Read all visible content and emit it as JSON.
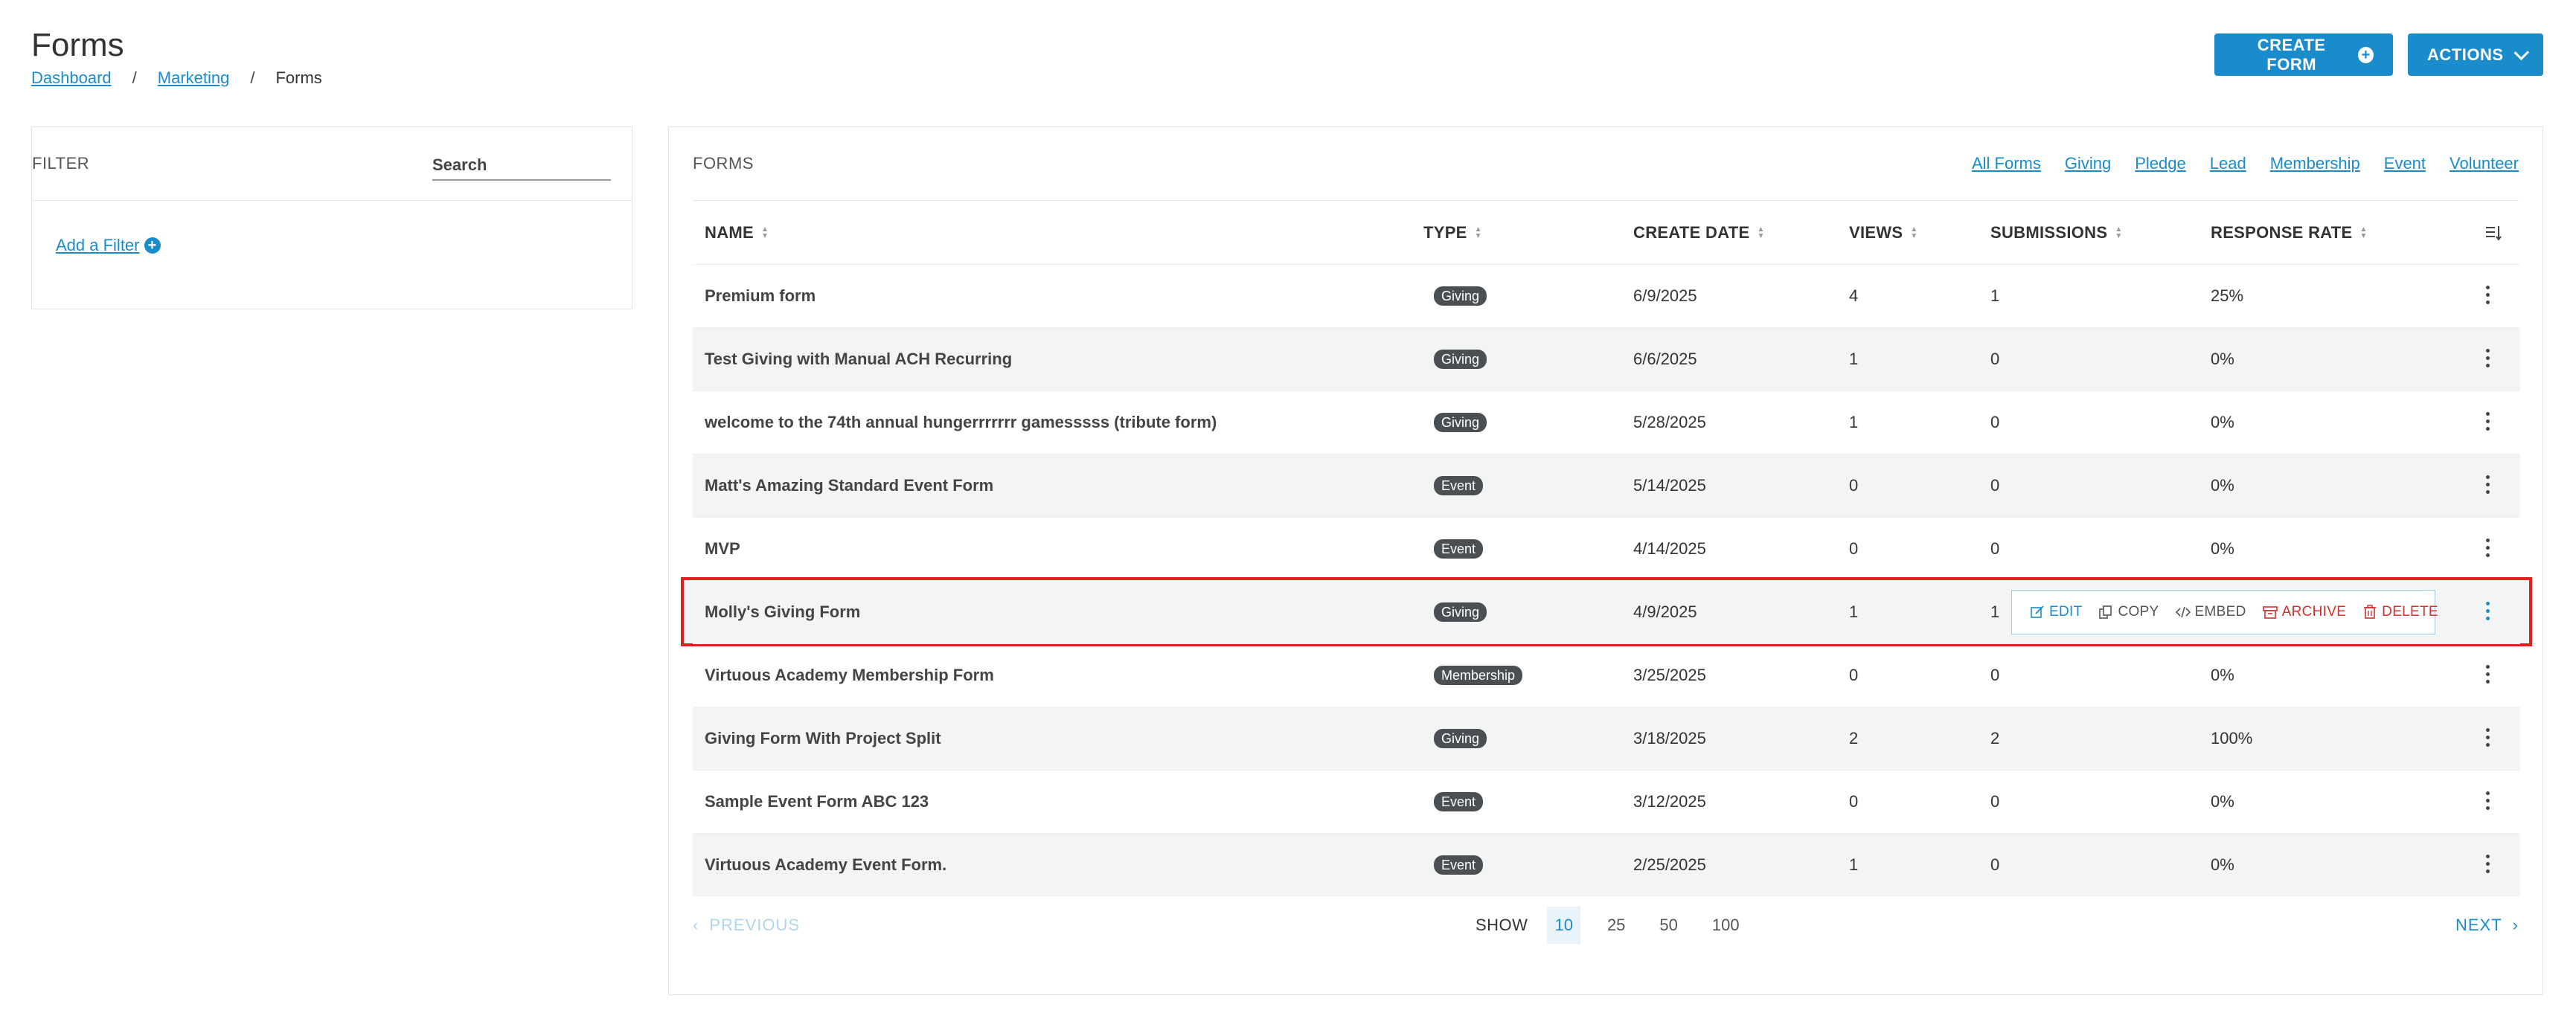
{
  "header": {
    "title": "Forms",
    "breadcrumb": [
      {
        "label": "Dashboard",
        "link": true
      },
      {
        "label": "Marketing",
        "link": true
      },
      {
        "label": "Forms",
        "link": false
      }
    ],
    "separator": "/",
    "create_label": "CREATE FORM",
    "create_icon": "plus-circle-icon",
    "actions_label": "ACTIONS",
    "actions_icon": "chevron-down-icon"
  },
  "filter": {
    "label": "FILTER",
    "search_placeholder": "Search",
    "add_filter_label": "Add a Filter"
  },
  "forms": {
    "label": "FORMS",
    "type_filters": [
      "All Forms",
      "Giving",
      "Pledge",
      "Lead",
      "Membership",
      "Event",
      "Volunteer"
    ],
    "columns": [
      "NAME",
      "TYPE",
      "CREATE DATE",
      "VIEWS",
      "SUBMISSIONS",
      "RESPONSE RATE"
    ],
    "rows": [
      {
        "name": "Premium form",
        "type": "Giving",
        "date": "6/9/2025",
        "views": "4",
        "submissions": "1",
        "rate": "25%"
      },
      {
        "name": "Test Giving with Manual ACH Recurring",
        "type": "Giving",
        "date": "6/6/2025",
        "views": "1",
        "submissions": "0",
        "rate": "0%"
      },
      {
        "name": "welcome to the 74th annual hungerrrrrrr gamesssss (tribute form)",
        "type": "Giving",
        "date": "5/28/2025",
        "views": "1",
        "submissions": "0",
        "rate": "0%"
      },
      {
        "name": "Matt's Amazing Standard Event Form",
        "type": "Event",
        "date": "5/14/2025",
        "views": "0",
        "submissions": "0",
        "rate": "0%"
      },
      {
        "name": "MVP",
        "type": "Event",
        "date": "4/14/2025",
        "views": "0",
        "submissions": "0",
        "rate": "0%"
      },
      {
        "name": "Molly's Giving Form",
        "type": "Giving",
        "date": "4/9/2025",
        "views": "1",
        "submissions": "1",
        "rate": ""
      },
      {
        "name": "Virtuous Academy Membership Form",
        "type": "Membership",
        "date": "3/25/2025",
        "views": "0",
        "submissions": "0",
        "rate": "0%"
      },
      {
        "name": "Giving Form With Project Split",
        "type": "Giving",
        "date": "3/18/2025",
        "views": "2",
        "submissions": "2",
        "rate": "100%"
      },
      {
        "name": "Sample Event Form ABC 123",
        "type": "Event",
        "date": "3/12/2025",
        "views": "0",
        "submissions": "0",
        "rate": "0%"
      },
      {
        "name": "Virtuous Academy Event Form.",
        "type": "Event",
        "date": "2/25/2025",
        "views": "1",
        "submissions": "0",
        "rate": "0%"
      }
    ],
    "row_actions": [
      "EDIT",
      "COPY",
      "EMBED",
      "ARCHIVE",
      "DELETE"
    ]
  },
  "pagination": {
    "previous_label": "PREVIOUS",
    "next_label": "NEXT",
    "show_label": "SHOW",
    "page_sizes": [
      "10",
      "25",
      "50",
      "100"
    ],
    "selected_page_size": "10"
  },
  "colors": {
    "accent": "#1a8ccc",
    "danger": "#d33030",
    "badge": "#4a4f54",
    "highlight_border": "#e02020"
  }
}
